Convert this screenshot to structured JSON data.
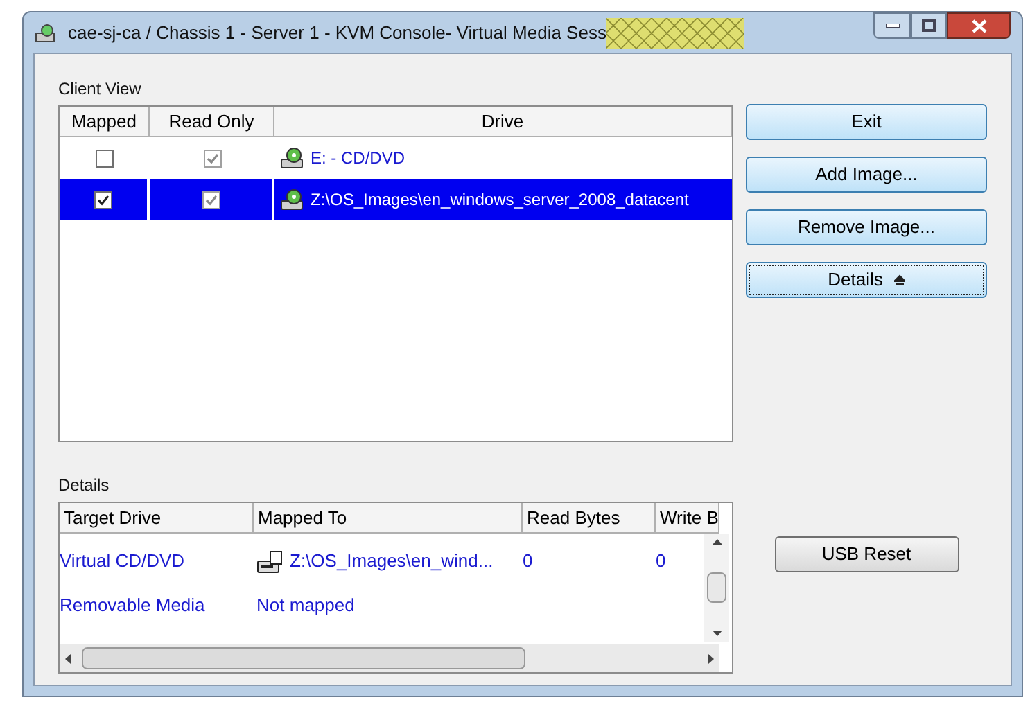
{
  "window": {
    "title": "cae-sj-ca / Chassis 1 - Server 1 - KVM Console- Virtual Media Sess"
  },
  "client_view": {
    "label": "Client View",
    "columns": [
      "Mapped",
      "Read Only",
      "Drive"
    ],
    "rows": [
      {
        "mapped": false,
        "read_only": true,
        "drive": "E: - CD/DVD",
        "selected": false
      },
      {
        "mapped": true,
        "read_only": true,
        "drive": "Z:\\OS_Images\\en_windows_server_2008_datacent",
        "selected": true
      }
    ]
  },
  "buttons": [
    {
      "label": "Exit",
      "focused": false,
      "arrow": false
    },
    {
      "label": "Add Image...",
      "focused": false,
      "arrow": false
    },
    {
      "label": "Remove Image...",
      "focused": false,
      "arrow": false
    },
    {
      "label": "Details",
      "focused": true,
      "arrow": true
    }
  ],
  "details": {
    "label": "Details",
    "columns": [
      "Target Drive",
      "Mapped To",
      "Read Bytes",
      "Write B"
    ],
    "rows": [
      {
        "target": "Virtual CD/DVD",
        "mapped_to": "Z:\\OS_Images\\en_wind...",
        "mapped": true,
        "read_bytes": "0",
        "write_bytes": "0"
      },
      {
        "target": "Removable Media",
        "mapped_to": "Not mapped",
        "mapped": false
      }
    ]
  },
  "usb_reset": {
    "label": "USB Reset"
  }
}
